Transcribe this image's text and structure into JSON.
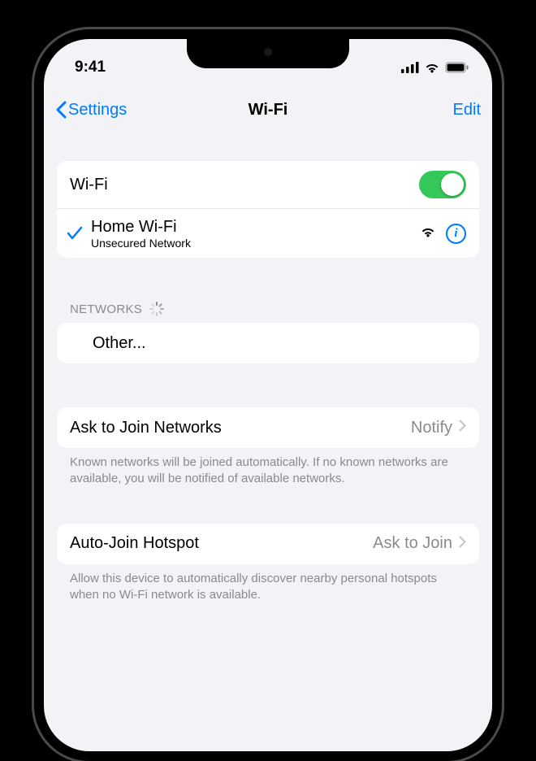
{
  "status": {
    "time": "9:41"
  },
  "nav": {
    "back_label": "Settings",
    "title": "Wi-Fi",
    "edit_label": "Edit"
  },
  "wifi": {
    "label": "Wi-Fi",
    "on": true
  },
  "current_network": {
    "name": "Home Wi-Fi",
    "subtitle": "Unsecured Network"
  },
  "networks_header": "NETWORKS",
  "other_label": "Other...",
  "ask_to_join": {
    "label": "Ask to Join Networks",
    "value": "Notify",
    "footer": "Known networks will be joined automatically. If no known networks are available, you will be notified of available networks."
  },
  "auto_join": {
    "label": "Auto-Join Hotspot",
    "value": "Ask to Join",
    "footer": "Allow this device to automatically discover nearby personal hotspots when no Wi-Fi network is available."
  }
}
